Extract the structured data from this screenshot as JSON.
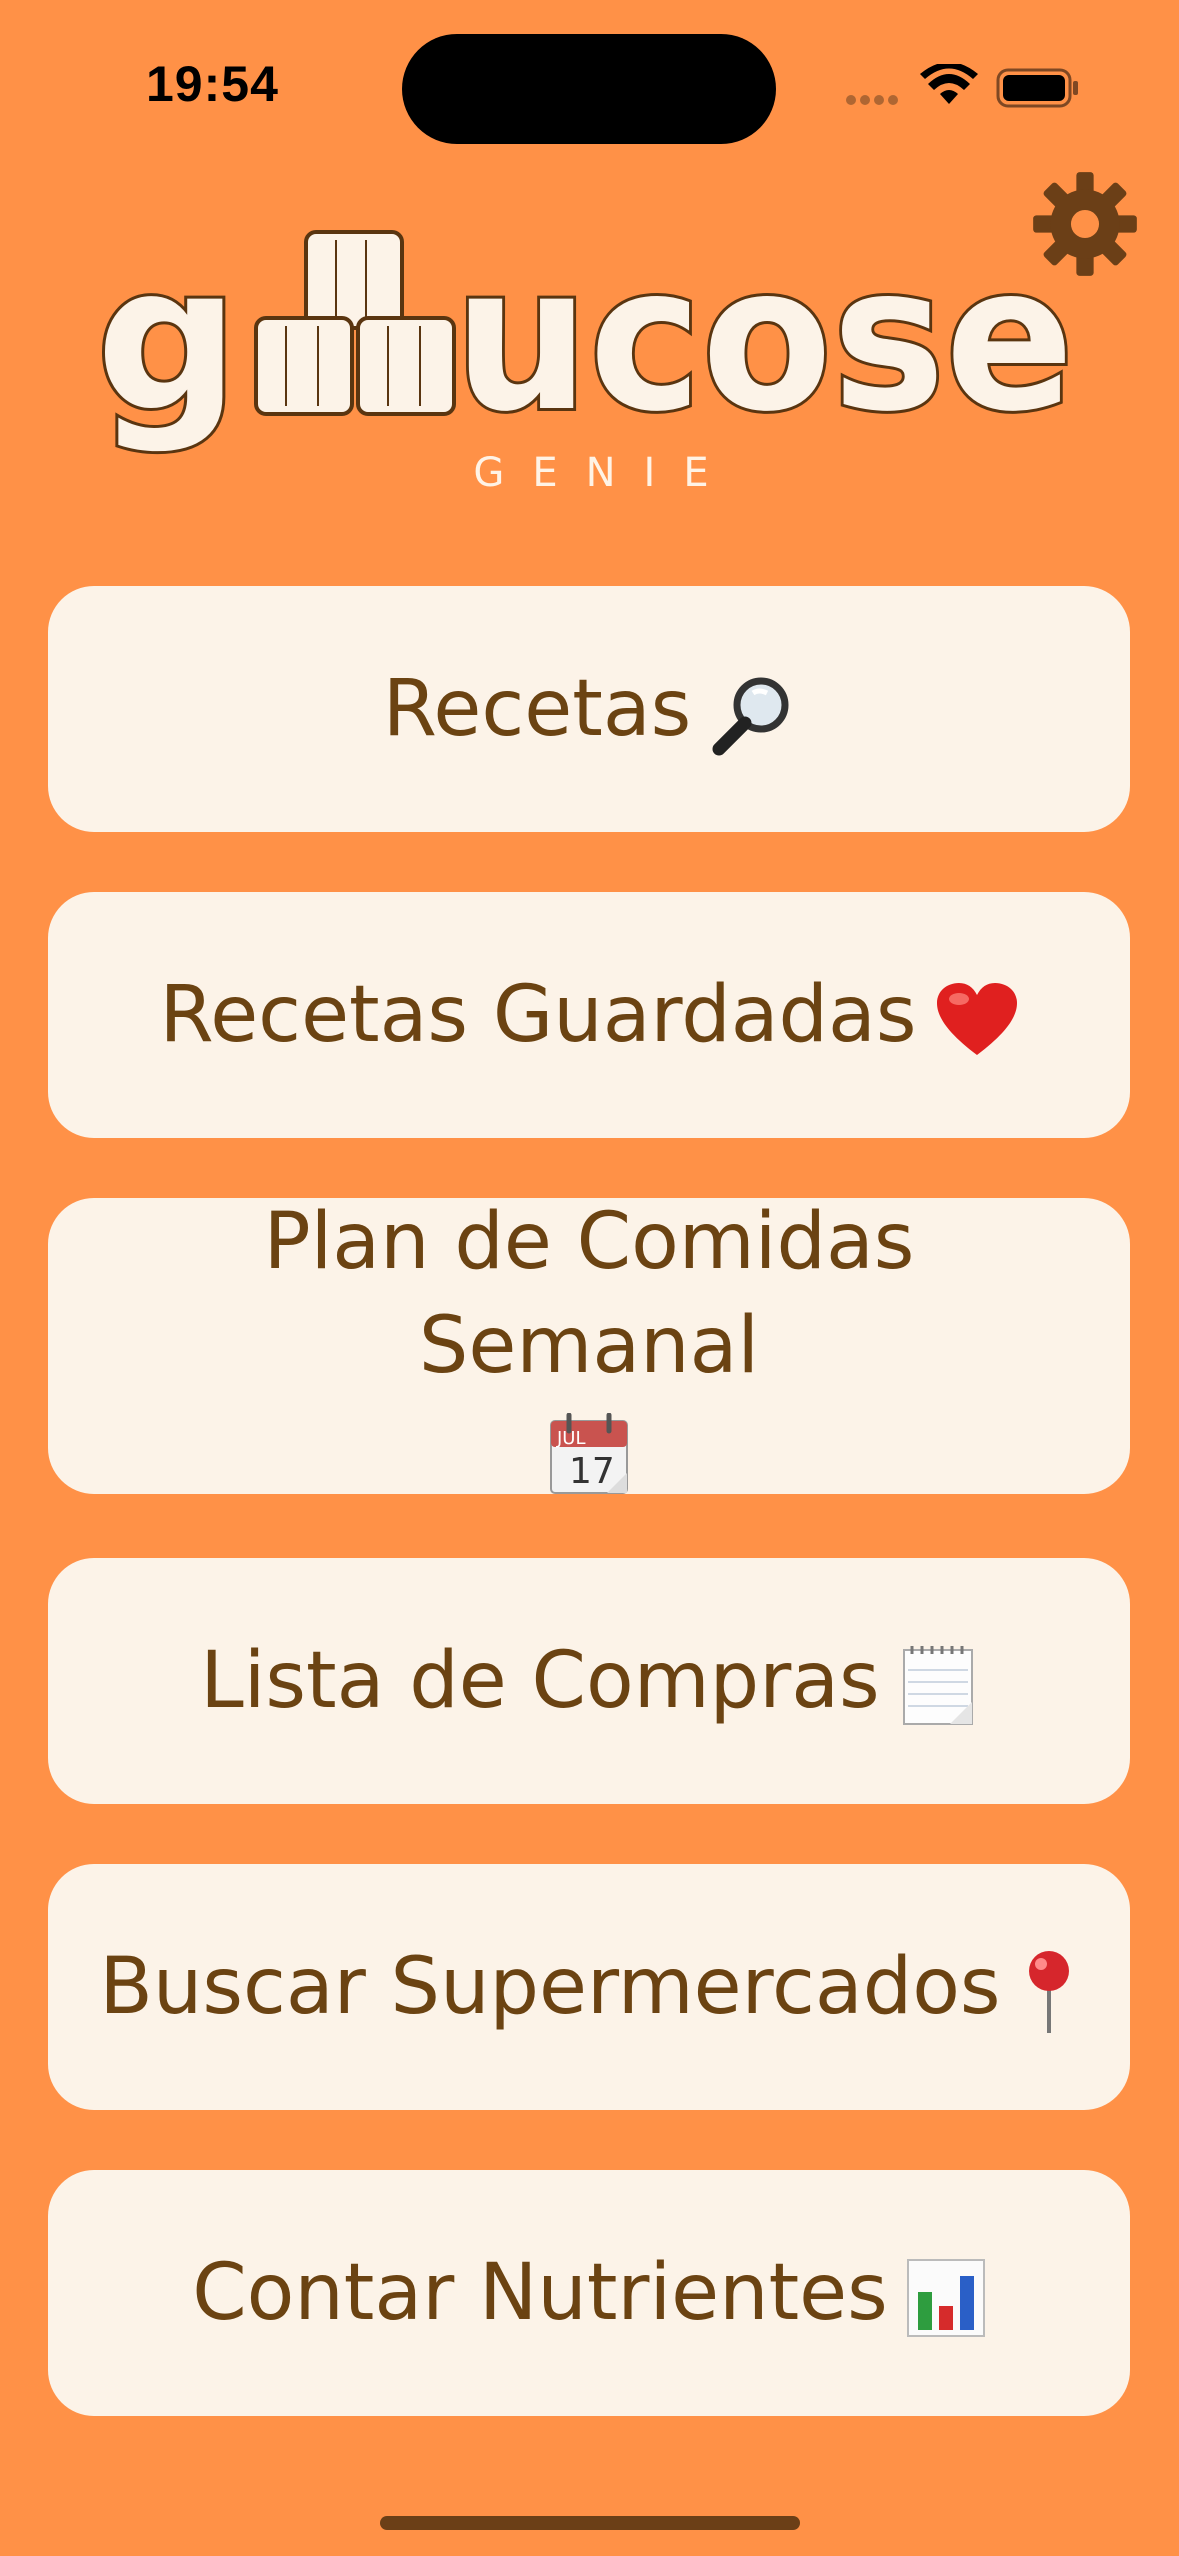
{
  "status_bar": {
    "time": "19:54",
    "icons": [
      "signal-icon",
      "wifi-icon",
      "battery-icon"
    ]
  },
  "header": {
    "settings_icon": "gear-icon",
    "logo_text": "glucose",
    "logo_subtitle": "GENIE"
  },
  "menu": {
    "items": [
      {
        "label": "Recetas",
        "icon": "magnifier-icon"
      },
      {
        "label": "Recetas Guardadas",
        "icon": "heart-icon"
      },
      {
        "label": "Plan de Comidas Semanal",
        "icon": "calendar-icon",
        "calendar_month": "JUL",
        "calendar_day": "17"
      },
      {
        "label": "Lista de Compras",
        "icon": "notepad-icon"
      },
      {
        "label": "Buscar Supermercados",
        "icon": "pushpin-icon"
      },
      {
        "label": "Contar Nutrientes",
        "icon": "bar-chart-icon"
      }
    ]
  },
  "colors": {
    "background": "#FF9147",
    "button_bg": "#FCF3E8",
    "button_text": "#6B4312",
    "gear": "#6B3F17"
  }
}
